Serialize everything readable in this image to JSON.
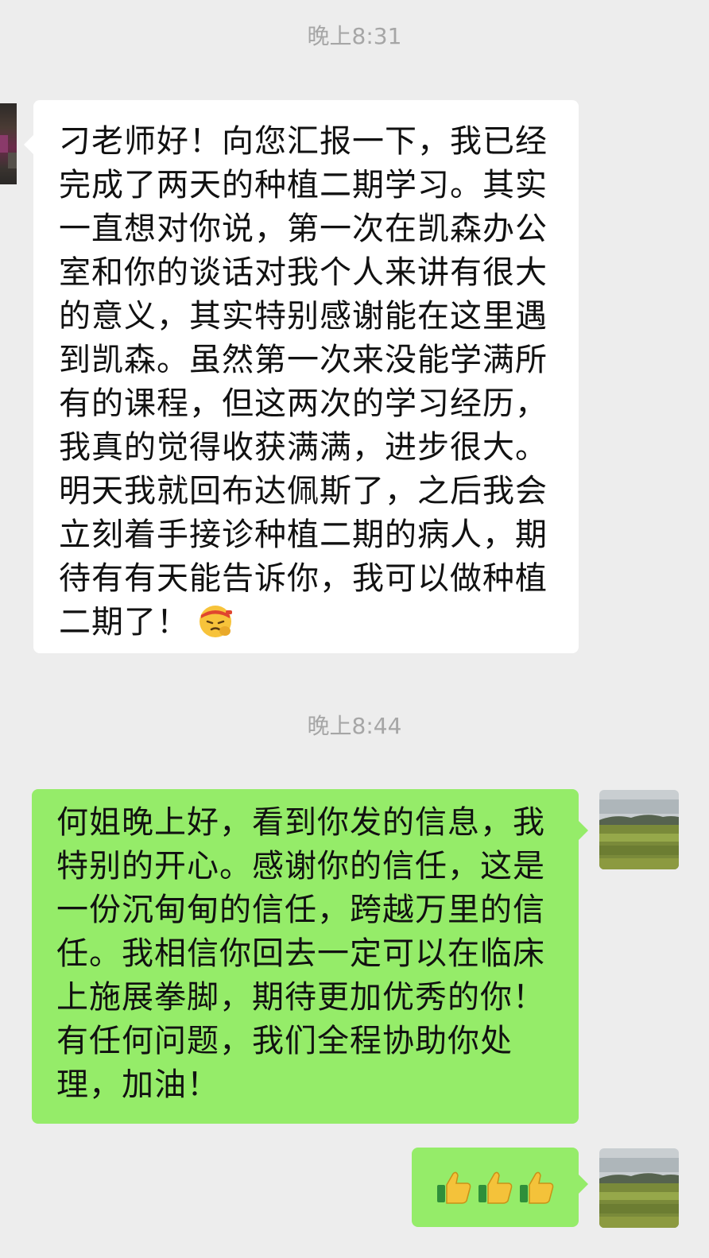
{
  "chat": {
    "timestamps": [
      "晚上8:31",
      "晚上8:44"
    ],
    "messages": [
      {
        "side": "incoming",
        "text": "刁老师好！向您汇报一下，我已经完成了两天的种植二期学习。其实一直想对你说，第一次在凯森办公室和你的谈话对我个人来讲有很大的意义，其实特别感谢能在这里遇到凯森。虽然第一次来没能学满所有的课程，但这两次的学习经历，我真的觉得收获满满，进步很大。明天我就回布达佩斯了，之后我会立刻着手接诊种植二期的病人，期待有有天能告诉你，我可以做种植二期了！",
        "emoji": "saluting-face-headband-emoji"
      },
      {
        "side": "outgoing",
        "text": "何姐晚上好，看到你发的信息，我特别的开心。感谢你的信任，这是一份沉甸甸的信任，跨越万里的信任。我相信你回去一定可以在临床上施展拳脚，期待更加优秀的你！有任何问题，我们全程协助你处理，加油！"
      },
      {
        "side": "outgoing",
        "emoji": "thumbs-up-emoji",
        "emoji_count": 3
      }
    ]
  },
  "colors": {
    "background": "#ededed",
    "incoming_bubble": "#ffffff",
    "outgoing_bubble": "#95ec69",
    "timestamp_text": "#a6a6a6"
  }
}
